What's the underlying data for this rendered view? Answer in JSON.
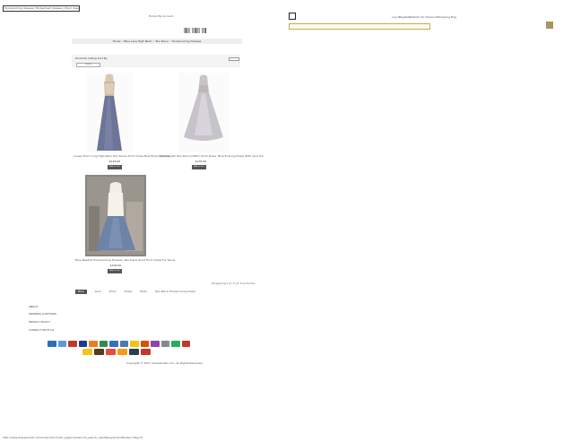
{
  "browser": {
    "tab_title": "Homecoming dresses | Bridesmaid dresses | Prom dresses | Wedding dresses",
    "status_url": "http://www.dressesmall.com/index.php?main_page=advanced_search_result&keyword=Blue&x=0&y=0"
  },
  "header": {
    "nav_home": "Home",
    "nav_account": "My Account"
  },
  "breadcrumb": {
    "text": "Home :: Blue Lace High Neck :: Two Piece :: Homecoming Dresses"
  },
  "listing": {
    "sort_label": "Products Listing Sort By",
    "sort_value": "Default",
    "products": [
      {
        "name": "Lovely Prom Long High-Neck Two Pieces Prom Dress Blue Evening Dress",
        "price": "$129.00",
        "button": "Add to Cart"
      },
      {
        "name": "Floor-length Two-Piece Chiffon Prom Dress, Blue Evening Dress With Lace Top",
        "price": "$135.00",
        "button": "Add to Cart"
      },
      {
        "name": "Blue Beaded Homecoming Dresses, Two Piece Short Prom Dress For Teens",
        "price": "$100.00",
        "button": "Add to Cart"
      }
    ],
    "pager": "Displaying 1 to 3 (of 3 products)"
  },
  "tags": [
    "Blue",
    "Lace",
    "Prom",
    "Dress",
    "Party",
    "Two-Piece Homecoming Dress"
  ],
  "footer": {
    "links": [
      "ABOUT",
      "SHIPPING & RETURN",
      "PRIVACY POLICY",
      "CONTACT WITH US"
    ],
    "copyright": "Copyright © 2017 dressesmall.com. All Rights Reserved.",
    "payment_icons": [
      {
        "name": "paypal-icon",
        "color": "#2f6fb8"
      },
      {
        "name": "amex-icon",
        "color": "#5a9bd5"
      },
      {
        "name": "mastercard-icon",
        "color": "#c0392b"
      },
      {
        "name": "visa-icon",
        "color": "#1a3d8f"
      },
      {
        "name": "discover-icon",
        "color": "#e67e22"
      },
      {
        "name": "jcb-icon",
        "color": "#2e8b57"
      },
      {
        "name": "diners-icon",
        "color": "#3b6fb5"
      },
      {
        "name": "moneybookers-icon",
        "color": "#4a7ab0"
      },
      {
        "name": "western-union-icon",
        "color": "#f1c40f"
      },
      {
        "name": "bank-transfer-icon",
        "color": "#d35400"
      },
      {
        "name": "giropay-icon",
        "color": "#8e44ad"
      },
      {
        "name": "sofort-icon",
        "color": "#7f8c8d"
      },
      {
        "name": "secure-icon",
        "color": "#27ae60"
      },
      {
        "name": "verisign-icon",
        "color": "#c0392b"
      }
    ],
    "shipping_icons": [
      {
        "name": "dhl-icon",
        "color": "#f3c319"
      },
      {
        "name": "ups-icon",
        "color": "#5a3a1a"
      },
      {
        "name": "ems-icon",
        "color": "#e74c3c"
      },
      {
        "name": "tnt-icon",
        "color": "#f39c12"
      },
      {
        "name": "usps-icon",
        "color": "#2c3e50"
      },
      {
        "name": "fedex-icon",
        "color": "#c0392b"
      }
    ]
  },
  "right_panel": {
    "nav": [
      "Log In",
      "Register",
      "Wishlist (0)",
      "Checkout",
      "Shopping Bag"
    ]
  }
}
